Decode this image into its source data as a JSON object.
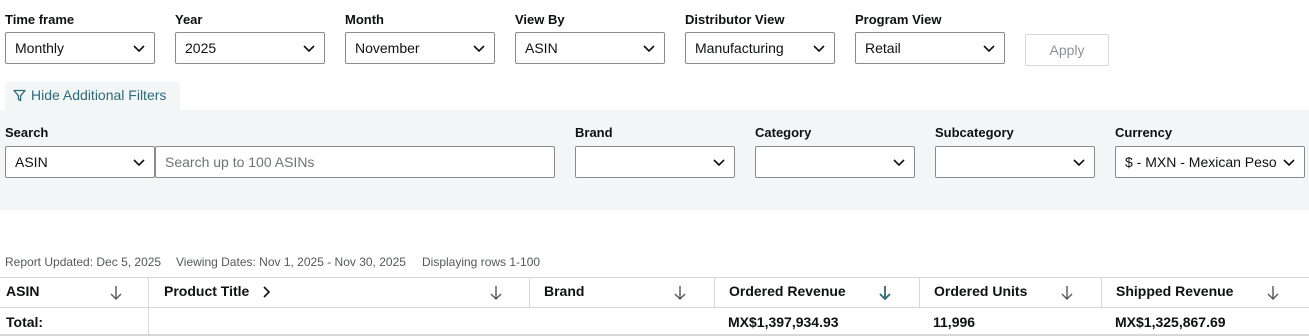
{
  "filters": [
    {
      "label": "Time frame",
      "value": "Monthly"
    },
    {
      "label": "Year",
      "value": "2025"
    },
    {
      "label": "Month",
      "value": "November"
    },
    {
      "label": "View By",
      "value": "ASIN"
    },
    {
      "label": "Distributor View",
      "value": "Manufacturing"
    },
    {
      "label": "Program View",
      "value": "Retail"
    }
  ],
  "apply_label": "Apply",
  "hide_filters_label": "Hide Additional Filters",
  "additional": {
    "search_label": "Search",
    "search_type_value": "ASIN",
    "search_placeholder": "Search up to 100 ASINs",
    "brand_label": "Brand",
    "brand_value": "",
    "category_label": "Category",
    "category_value": "",
    "subcategory_label": "Subcategory",
    "subcategory_value": "",
    "currency_label": "Currency",
    "currency_value": "$ - MXN - Mexican Peso"
  },
  "report_meta": {
    "updated": "Report Updated: Dec 5, 2025",
    "dates": "Viewing Dates: Nov 1, 2025 - Nov 30, 2025",
    "rows": "Displaying rows 1-100"
  },
  "table": {
    "columns": [
      "ASIN",
      "Product Title",
      "Brand",
      "Ordered Revenue",
      "Ordered Units",
      "Shipped Revenue"
    ],
    "total_label": "Total:",
    "totals": {
      "ordered_revenue": "MX$1,397,934.93",
      "ordered_units": "11,996",
      "shipped_revenue": "MX$1,325,867.69"
    }
  }
}
